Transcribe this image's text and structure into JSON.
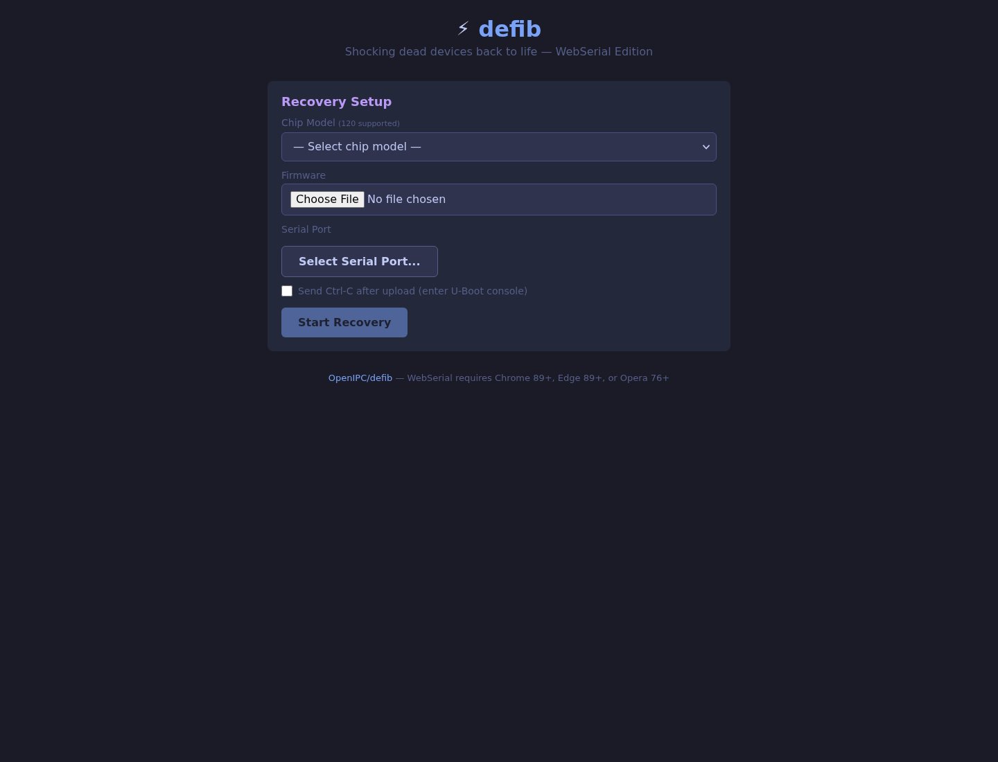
{
  "header": {
    "icon": "⚡",
    "title": "defib",
    "subtitle": "Shocking dead devices back to life — WebSerial Edition"
  },
  "setup": {
    "title": "Recovery Setup",
    "chip_model": {
      "label": "Chip Model",
      "note": "(120 supported)",
      "selected_option": "— Select chip model —"
    },
    "firmware": {
      "label": "Firmware",
      "button": "Choose File",
      "status": "No file chosen"
    },
    "serial_port": {
      "label": "Serial Port",
      "button": "Select Serial Port..."
    },
    "send_ctrl_c": {
      "label": "Send Ctrl-C after upload (enter U-Boot console)",
      "checked": false
    },
    "start_button": {
      "label": "Start Recovery",
      "disabled": true
    }
  },
  "footer": {
    "link": "OpenIPC/defib",
    "text": "— WebSerial requires Chrome 89+, Edge 89+, or Opera 76+"
  }
}
